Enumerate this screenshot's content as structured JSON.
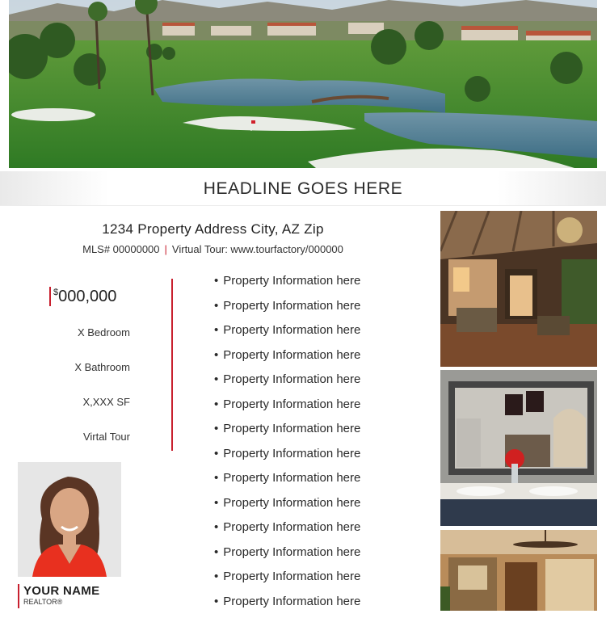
{
  "headline": "HEADLINE GOES HERE",
  "address": "1234 Property Address City, AZ Zip",
  "mls": {
    "number": "MLS# 00000000",
    "separator": "|",
    "tour": "Virtual Tour: www.tourfactory/000000"
  },
  "price": {
    "currency": "$",
    "amount": "000,000"
  },
  "stats": {
    "bedrooms": "X Bedroom",
    "bathrooms": "X Bathroom",
    "sqft": "X,XXX SF",
    "tour": "Virtal Tour"
  },
  "property_info": [
    "Property Information here",
    "Property Information here",
    "Property Information here",
    "Property Information here",
    "Property Information here",
    "Property Information here",
    "Property Information here",
    "Property Information here",
    "Property Information here",
    "Property Information here",
    "Property Information here",
    "Property Information here",
    "Property Information here",
    "Property Information here"
  ],
  "agent": {
    "name": "YOUR NAME",
    "title": "REALTOR®"
  },
  "colors": {
    "accent": "#c8202f",
    "text": "#222222"
  }
}
